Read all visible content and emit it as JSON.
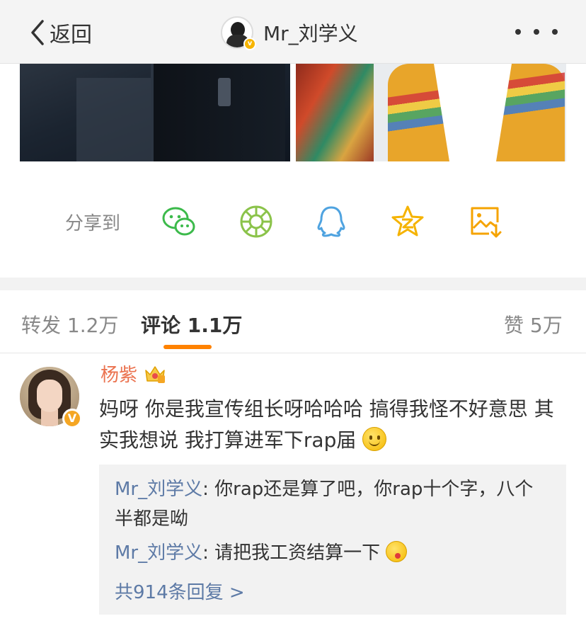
{
  "nav": {
    "back_label": "返回",
    "title": "Mr_刘学义"
  },
  "share": {
    "label": "分享到",
    "icons": [
      "wechat-icon",
      "moments-icon",
      "qq-icon",
      "qzone-icon",
      "save-image-icon"
    ],
    "colors": {
      "wechat": "#3cba4b",
      "moments": "#8bc34a",
      "qq": "#4fa3e0",
      "qzone": "#f5b300",
      "save": "#f5a300"
    }
  },
  "tabs": {
    "repost": "转发 1.2万",
    "comment": "评论 1.1万",
    "like": "赞 5万"
  },
  "comment": {
    "author": "杨紫",
    "text": "妈呀 你是我宣传组长呀哈哈哈  搞得我怪不好意思 其实我想说 我打算进军下rap届"
  },
  "replies": [
    {
      "author": "Mr_刘学义",
      "text": ": 你rap还是算了吧，你rap十个字，八个半都是呦"
    },
    {
      "author": "Mr_刘学义",
      "text": ": 请把我工资结算一下"
    }
  ],
  "more_replies": "共914条回复 >",
  "colors": {
    "accent": "#ff8200",
    "name_orange": "#eb7350",
    "link_blue": "#5d7aa6"
  }
}
